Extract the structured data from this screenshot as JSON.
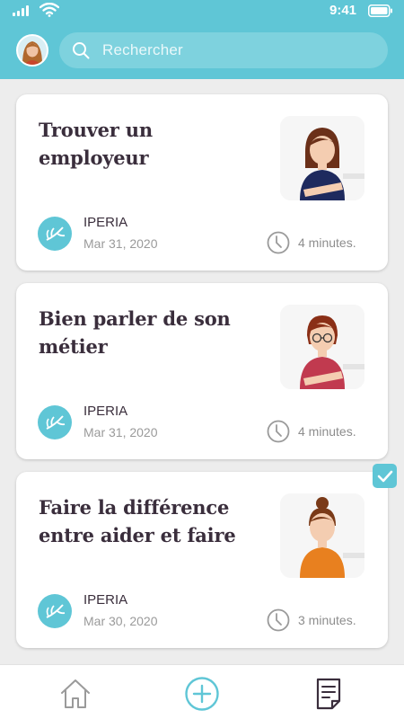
{
  "status_bar": {
    "time": "9:41"
  },
  "search": {
    "placeholder": "Rechercher"
  },
  "cards": [
    {
      "title": "Trouver un employeur",
      "org": "IPERIA",
      "date": "Mar 31, 2020",
      "duration": "4 minutes.",
      "completed": false,
      "top_color": "#1e2a5e",
      "hair_color": "#6b3019"
    },
    {
      "title": "Bien parler de son métier",
      "org": "IPERIA",
      "date": "Mar 31, 2020",
      "duration": "4 minutes.",
      "completed": false,
      "top_color": "#c13a4f",
      "hair_color": "#8a2f16"
    },
    {
      "title": "Faire la différence entre aider et faire",
      "org": "IPERIA",
      "date": "Mar 30, 2020",
      "duration": "3 minutes.",
      "completed": true,
      "top_color": "#e8801f",
      "hair_color": "#7a3a18"
    }
  ],
  "icons": {
    "search": "search-icon",
    "clock": "clock-icon",
    "nav_home": "home-icon",
    "nav_add": "plus-circle-icon",
    "nav_docs": "document-icon"
  },
  "colors": {
    "accent": "#5fc6d6",
    "title_text": "#3a2e3c"
  }
}
